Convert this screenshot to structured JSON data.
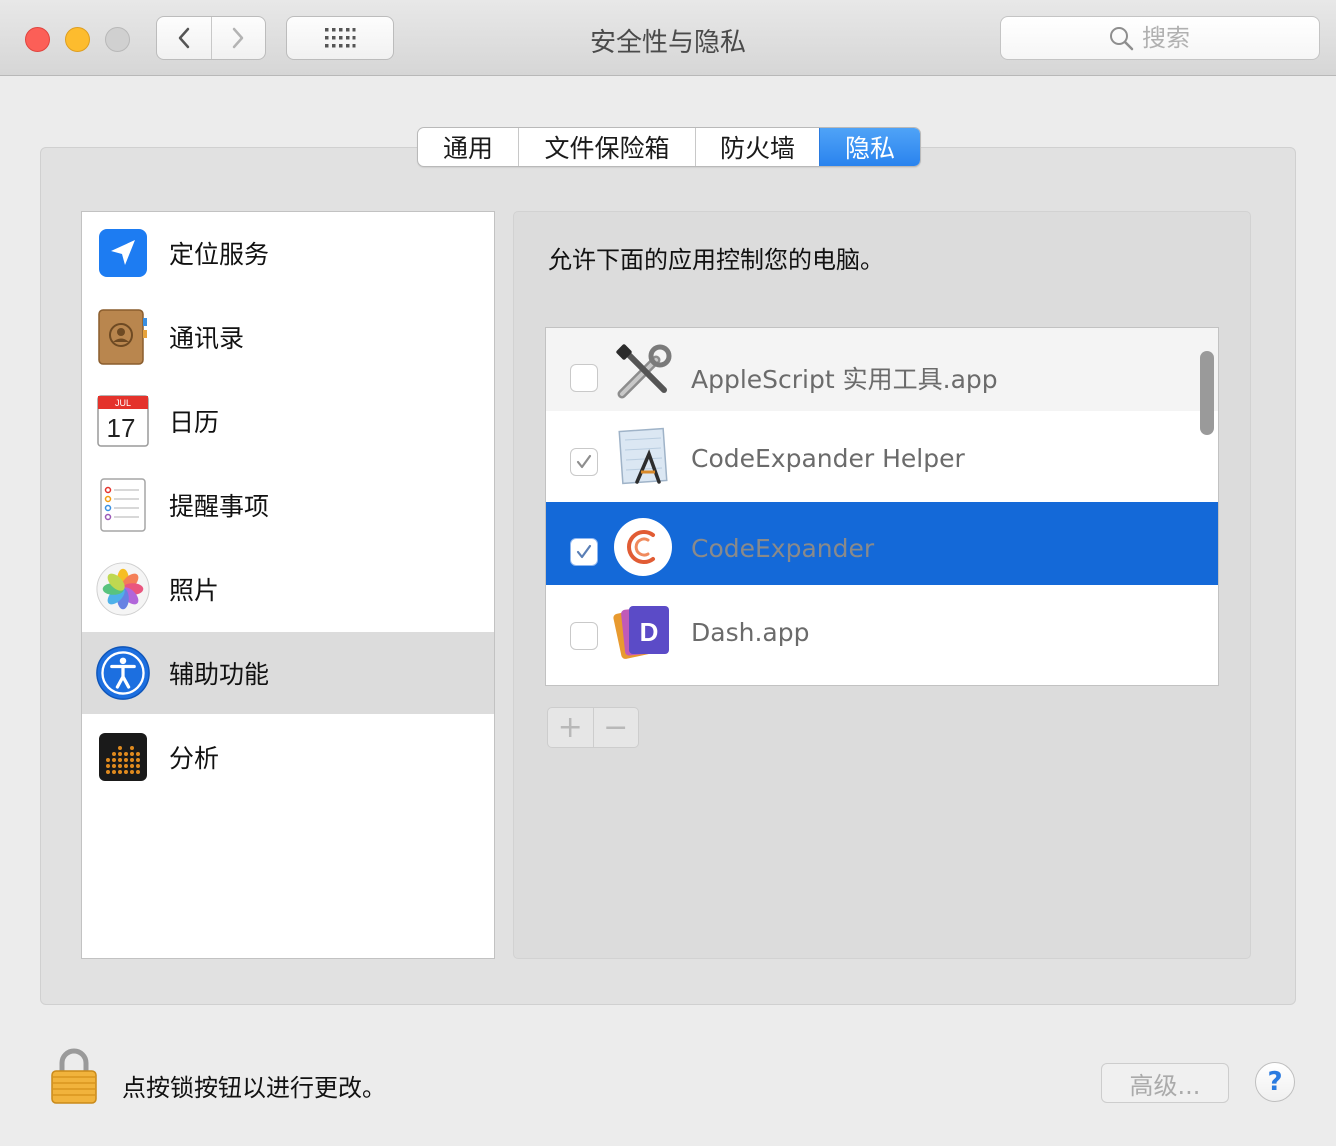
{
  "window": {
    "title": "安全性与隐私",
    "search_placeholder": "搜索"
  },
  "tabs": [
    {
      "label": "通用",
      "selected": false
    },
    {
      "label": "文件保险箱",
      "selected": false
    },
    {
      "label": "防火墙",
      "selected": false
    },
    {
      "label": "隐私",
      "selected": true
    }
  ],
  "sidebar": {
    "items": [
      {
        "label": "定位服务",
        "icon": "location-arrow-icon",
        "selected": false
      },
      {
        "label": "通讯录",
        "icon": "contacts-book-icon",
        "selected": false
      },
      {
        "label": "日历",
        "icon": "calendar-icon",
        "selected": false,
        "calendar_month": "JUL",
        "calendar_day": "17"
      },
      {
        "label": "提醒事项",
        "icon": "reminders-icon",
        "selected": false
      },
      {
        "label": "照片",
        "icon": "photos-icon",
        "selected": false
      },
      {
        "label": "辅助功能",
        "icon": "accessibility-icon",
        "selected": true
      },
      {
        "label": "分析",
        "icon": "analytics-icon",
        "selected": false
      }
    ]
  },
  "main": {
    "description": "允许下面的应用控制您的电脑。",
    "apps": [
      {
        "label": "AppleScript 实用工具.app",
        "checked": false,
        "selected": false,
        "icon": "applescript-utility-icon"
      },
      {
        "label": "CodeExpander Helper",
        "checked": true,
        "selected": false,
        "icon": "codeexpander-helper-icon"
      },
      {
        "label": "CodeExpander",
        "checked": true,
        "selected": true,
        "icon": "codeexpander-icon"
      },
      {
        "label": "Dash.app",
        "checked": false,
        "selected": false,
        "icon": "dash-icon"
      }
    ],
    "add_label": "+",
    "remove_label": "−"
  },
  "footer": {
    "lock_text": "点按锁按钮以进行更改。",
    "advanced_label": "高级...",
    "help_label": "?"
  },
  "colors": {
    "accent": "#2a83ee",
    "selection": "#1469d8",
    "close": "#fc5f57",
    "minimize": "#fdbc2e"
  }
}
